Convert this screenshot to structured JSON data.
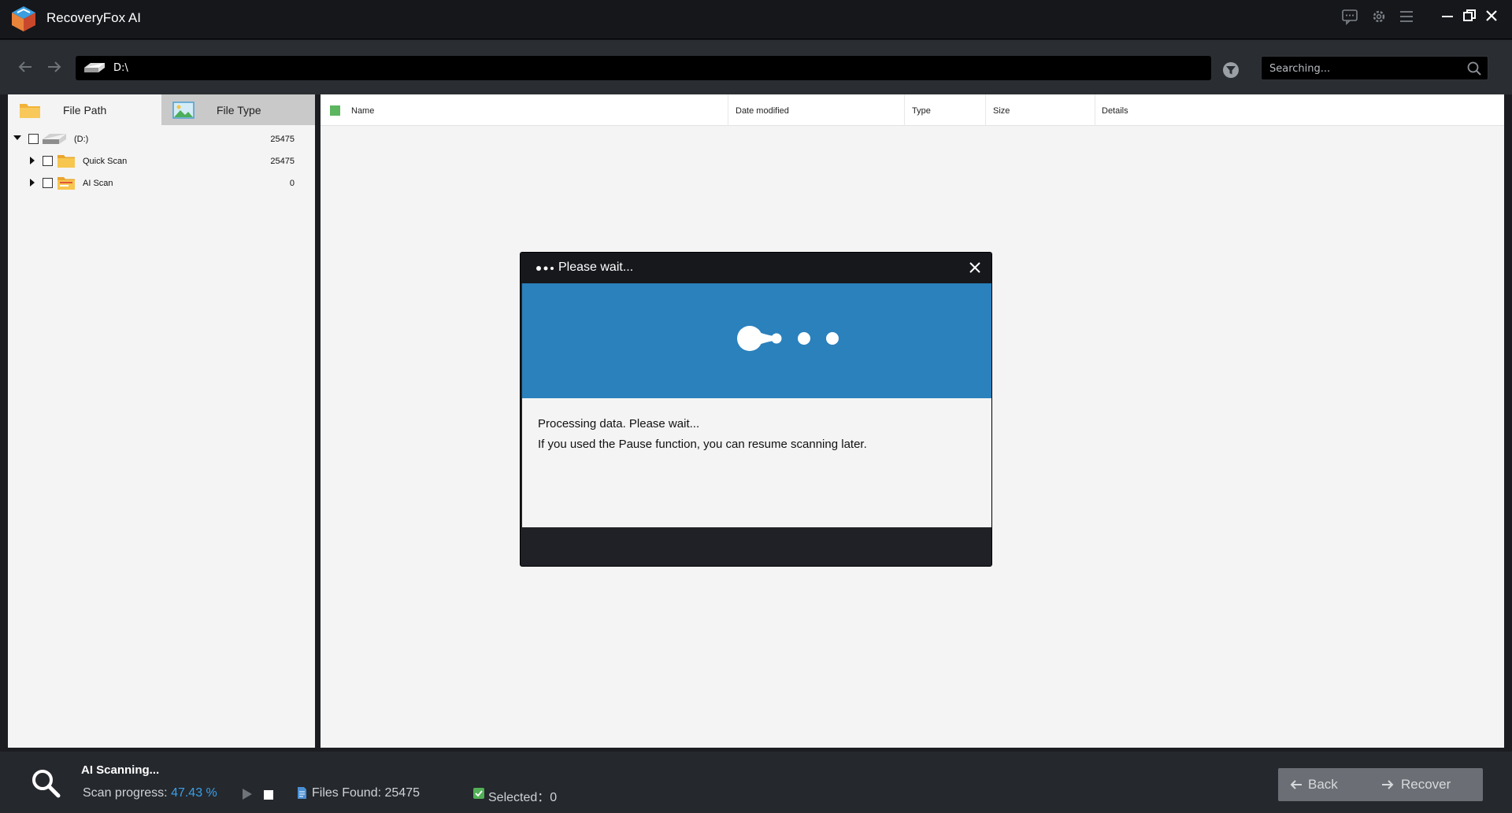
{
  "app": {
    "title": "RecoveryFox AI",
    "icons": [
      "feedback-icon",
      "settings-icon",
      "menu-icon",
      "minimize-icon",
      "restore-icon",
      "close-icon"
    ]
  },
  "address": {
    "path": "D:\\",
    "search_placeholder": "Searching..."
  },
  "left_panel": {
    "tabs": [
      {
        "label": "File Path",
        "active": true
      },
      {
        "label": "File Type",
        "active": false
      }
    ],
    "tree": [
      {
        "label": "(D:)",
        "count": "25475",
        "expanded": true
      },
      {
        "label": "Quick Scan",
        "count": "25475",
        "expanded": false
      },
      {
        "label": "AI Scan",
        "count": "0",
        "expanded": false
      }
    ]
  },
  "file_list": {
    "columns": [
      "Name",
      "Date modified",
      "Type",
      "Size",
      "Details"
    ]
  },
  "modal": {
    "title": "Please wait...",
    "line1": "Processing data. Please wait...",
    "line2": "If you used the Pause function, you can resume scanning later.",
    "banner_color": "#2a81bc"
  },
  "status": {
    "title": "AI Scanning...",
    "progress_label": "Scan progress:",
    "progress_value": "47.43 %",
    "progress_percent": 47.43,
    "files_found_label": "Files Found:",
    "files_found": "25475",
    "selected_label": "Selected：",
    "selected": "0",
    "back_label": "Back",
    "recover_label": "Recover",
    "accent_color": "#3aa0e8"
  }
}
